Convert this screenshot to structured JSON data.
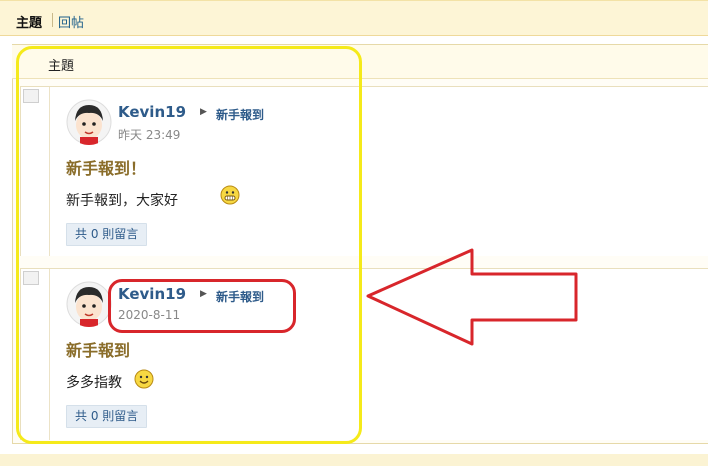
{
  "tabs": {
    "topics": "主題",
    "replies": "回帖"
  },
  "list_header": {
    "label": "主題"
  },
  "posts": [
    {
      "author": "Kevin19",
      "forum": "新手報到",
      "date": "昨天 23:49",
      "title": "新手報到！",
      "content": "新手報到，大家好",
      "emoji": "grin-emoji-icon",
      "reply_text": "共 0 則留言"
    },
    {
      "author": "Kevin19",
      "forum": "新手報到",
      "date": "2020-8-11",
      "title": "新手報到",
      "content": "多多指教",
      "emoji": "smile-emoji-icon",
      "reply_text": "共 0 則留言"
    }
  ],
  "colors": {
    "link": "#2e5b8a",
    "title": "#8a6d2a",
    "highlight_yellow": "#f5ea1a",
    "highlight_red": "#d8262b"
  }
}
